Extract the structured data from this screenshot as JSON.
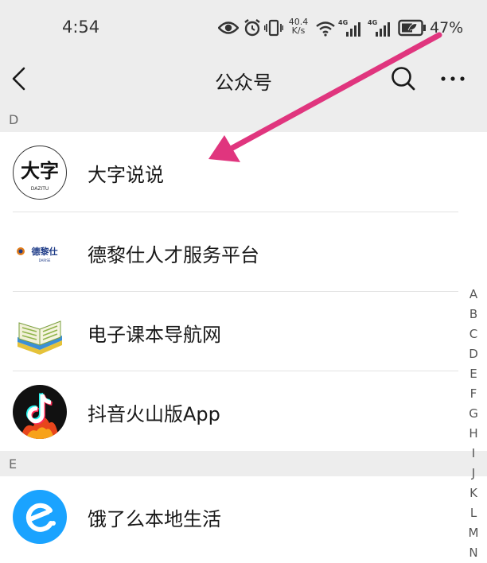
{
  "status_bar": {
    "time": "4:54",
    "net_speed_value": "40.4",
    "net_speed_unit": "K/s",
    "signal1_label": "4G",
    "signal2_label": "4G",
    "battery_percent": "47%",
    "icons": [
      "eye-icon",
      "alarm-icon",
      "vibrate-icon",
      "wifi-icon",
      "signal-icon",
      "battery-icon"
    ]
  },
  "nav": {
    "title": "公众号",
    "back_icon": "chevron-left-icon",
    "search_icon": "search-icon",
    "more_icon": "more-icon"
  },
  "sections": [
    {
      "letter": "D",
      "items": [
        {
          "name": "大字说说",
          "avatar_text": "大字",
          "avatar_subtext": "DAZITU"
        },
        {
          "name": "德黎仕人才服务平台",
          "avatar_text": "德黎仕",
          "avatar_subtext": "DARISE"
        },
        {
          "name": "电子课本导航网"
        },
        {
          "name": "抖音火山版App"
        }
      ]
    },
    {
      "letter": "E",
      "items": [
        {
          "name": "饿了么本地生活"
        }
      ]
    }
  ],
  "index_bar": [
    "A",
    "B",
    "C",
    "D",
    "E",
    "F",
    "G",
    "H",
    "I",
    "J",
    "K",
    "L",
    "M",
    "N"
  ],
  "colors": {
    "background_gray": "#ededed",
    "annotation_arrow": "#e0357e",
    "eleme_blue": "#1aa3ff"
  }
}
